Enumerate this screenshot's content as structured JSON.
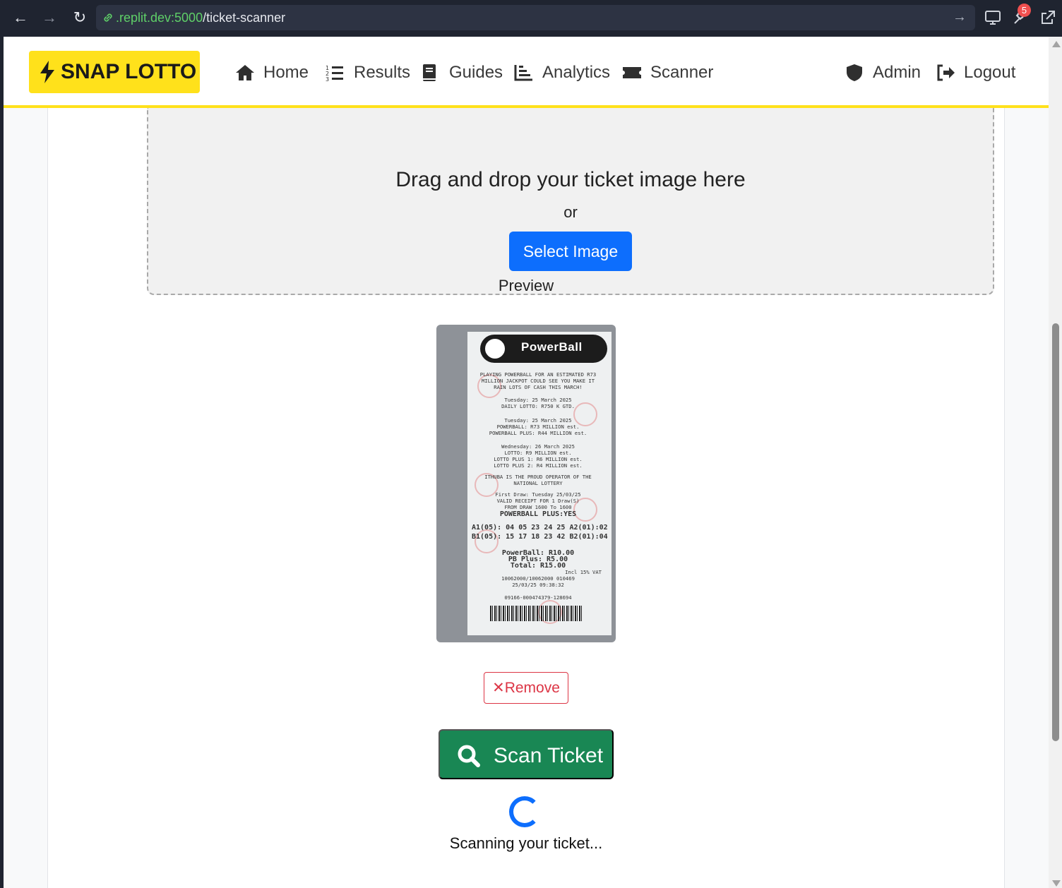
{
  "browser": {
    "url_domain": ".replit.dev:5000",
    "url_path": "/ticket-scanner",
    "extensions_badge": "5"
  },
  "navbar": {
    "brand": "SNAP LOTTO",
    "items": [
      {
        "label": "Home",
        "icon": "home-icon"
      },
      {
        "label": "Results",
        "icon": "list-ol-icon"
      },
      {
        "label": "Guides",
        "icon": "book-icon"
      },
      {
        "label": "Analytics",
        "icon": "chart-line-icon"
      },
      {
        "label": "Scanner",
        "icon": "ticket-icon"
      }
    ],
    "right_items": [
      {
        "label": "Admin",
        "icon": "shield-icon"
      },
      {
        "label": "Logout",
        "icon": "sign-out-icon"
      }
    ]
  },
  "upload": {
    "drag_text": "Drag and drop your ticket image here",
    "or_text": "or",
    "select_button": "Select Image"
  },
  "preview": {
    "label": "Preview",
    "ticket": {
      "brand": "PowerBall",
      "lines": [
        "PLAYING POWERBALL FOR AN ESTIMATED R73",
        "MILLION JACKPOT COULD SEE YOU MAKE IT",
        "RAIN LOTS OF CASH THIS MARCH!",
        "Tuesday: 25 March 2025",
        "DAILY LOTTO: R750 K GTD.",
        "Tuesday: 25 March 2025",
        "POWERBALL:       R73 MILLION est.",
        "POWERBALL PLUS: R44 MILLION est.",
        "Wednesday: 26 March 2025",
        "LOTTO:           R9 MILLION est.",
        "LOTTO PLUS 1:    R6 MILLION est.",
        "LOTTO PLUS 2:    R4 MILLION est.",
        "ITHUBA IS THE PROUD OPERATOR OF THE",
        "NATIONAL LOTTERY",
        "First Draw: Tuesday 25/03/25",
        "VALID RECEIPT FOR 1 Draw(S)",
        "FROM DRAW 1600 To 1600",
        "POWERBALL PLUS:YES",
        "A1(05): 04 05 23 24 25 A2(01):02",
        "B1(05): 15 17 18 23 42 B2(01):04",
        "PowerBall:    R10.00",
        "PB Plus:       R5.00",
        "Total:        R15.00",
        "Incl 15% VAT",
        "10062000/10062000     010469",
        "25/03/25            09:38:32",
        "09166-000474379-128694"
      ]
    },
    "remove_button": "Remove"
  },
  "actions": {
    "scan_button": "Scan Ticket",
    "status_text": "Scanning your ticket..."
  },
  "colors": {
    "brand_yellow": "#ffe11b",
    "primary": "#0d6efd",
    "success": "#198754",
    "danger": "#dc3545"
  }
}
